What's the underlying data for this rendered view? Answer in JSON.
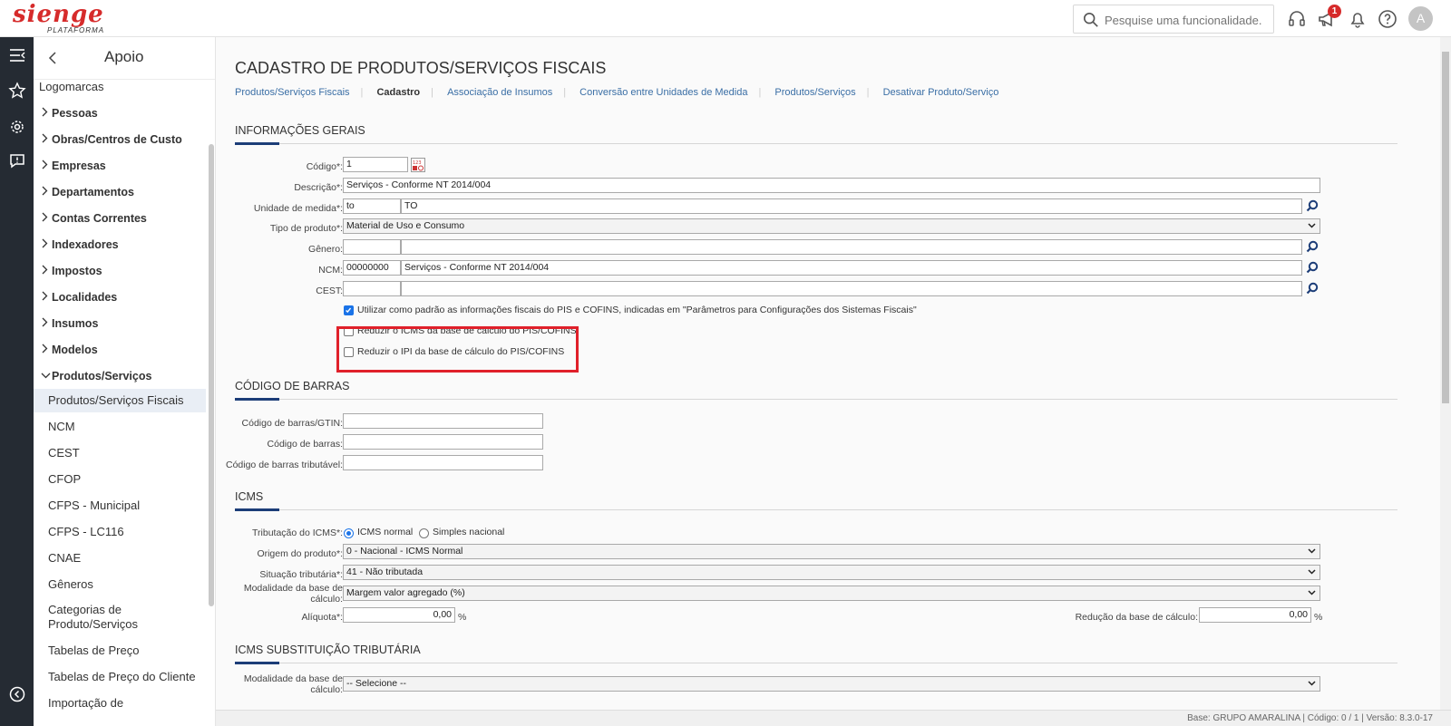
{
  "logo": {
    "brand": "sienge",
    "sub": "PLATAFORMA"
  },
  "search": {
    "placeholder": "Pesquise uma funcionalidade."
  },
  "notifications": {
    "count": "1"
  },
  "user": {
    "initial": "A"
  },
  "sidebar": {
    "title": "Apoio",
    "items": [
      {
        "label": "Logomarcas",
        "kind": "leaf"
      },
      {
        "label": "Pessoas",
        "kind": "group",
        "open": false
      },
      {
        "label": "Obras/Centros de Custo",
        "kind": "group",
        "open": false
      },
      {
        "label": "Empresas",
        "kind": "group",
        "open": false
      },
      {
        "label": "Departamentos",
        "kind": "group",
        "open": false
      },
      {
        "label": "Contas Correntes",
        "kind": "group",
        "open": false
      },
      {
        "label": "Indexadores",
        "kind": "group",
        "open": false
      },
      {
        "label": "Impostos",
        "kind": "group",
        "open": false
      },
      {
        "label": "Localidades",
        "kind": "group",
        "open": false
      },
      {
        "label": "Insumos",
        "kind": "group",
        "open": false
      },
      {
        "label": "Modelos",
        "kind": "group",
        "open": false
      },
      {
        "label": "Produtos/Serviços",
        "kind": "group",
        "open": true
      },
      {
        "label": "Produtos/Serviços Fiscais",
        "kind": "sub",
        "active": true
      },
      {
        "label": "NCM",
        "kind": "sub"
      },
      {
        "label": "CEST",
        "kind": "sub"
      },
      {
        "label": "CFOP",
        "kind": "sub"
      },
      {
        "label": "CFPS - Municipal",
        "kind": "sub"
      },
      {
        "label": "CFPS - LC116",
        "kind": "sub"
      },
      {
        "label": "CNAE",
        "kind": "sub"
      },
      {
        "label": "Gêneros",
        "kind": "sub"
      },
      {
        "label": "Categorias de Produto/Serviços",
        "kind": "sub"
      },
      {
        "label": "Tabelas de Preço",
        "kind": "sub"
      },
      {
        "label": "Tabelas de Preço do Cliente",
        "kind": "sub"
      },
      {
        "label": "Importação de",
        "kind": "sub"
      }
    ]
  },
  "page": {
    "title": "CADASTRO DE PRODUTOS/SERVIÇOS FISCAIS"
  },
  "tabs": [
    "Produtos/Serviços Fiscais",
    "Cadastro",
    "Associação de Insumos",
    "Conversão entre Unidades de Medida",
    "Produtos/Serviços",
    "Desativar Produto/Serviço"
  ],
  "general": {
    "section": "INFORMAÇÕES GERAIS",
    "codigo_label": "Código*:",
    "codigo": "1",
    "descricao_label": "Descrição*:",
    "descricao": "Serviços - Conforme NT 2014/004",
    "unidade_label": "Unidade de medida*:",
    "unidade_code": "to",
    "unidade_name": "TO",
    "tipo_label": "Tipo de produto*:",
    "tipo": "Material de Uso e Consumo",
    "genero_label": "Gênero:",
    "genero_code": "",
    "genero_name": "",
    "ncm_label": "NCM:",
    "ncm_code": "00000000",
    "ncm_name": "Serviços - Conforme NT 2014/004",
    "cest_label": "CEST:",
    "cest_code": "",
    "cest_name": "",
    "cb1": "Utilizar como padrão as informações fiscais do PIS e COFINS, indicadas em \"Parâmetros para Configurações dos Sistemas Fiscais\"",
    "cb2": "Reduzir o ICMS da base de cálculo do PIS/COFINS",
    "cb3": "Reduzir o IPI da base de cálculo do PIS/COFINS"
  },
  "barcode": {
    "section": "CÓDIGO DE BARRAS",
    "gtin_label": "Código de barras/GTIN:",
    "gtin": "",
    "code_label": "Código de barras:",
    "code": "",
    "trib_label": "Código de barras tributável:",
    "trib": ""
  },
  "icms": {
    "section": "ICMS",
    "trib_label": "Tributação do ICMS*:",
    "opt1": "ICMS normal",
    "opt2": "Simples nacional",
    "origem_label": "Origem do produto*:",
    "origem": "0 - Nacional - ICMS Normal",
    "situacao_label": "Situação tributária*:",
    "situacao": "41 - Não tributada",
    "modal_label1": "Modalidade da base de",
    "modal_label2": "cálculo:",
    "modal": "Margem valor agregado (%)",
    "aliquota_label": "Alíquota*:",
    "aliquota": "0,00",
    "pct": "%",
    "reducao_label": "Redução da base de cálculo:",
    "reducao": "0,00"
  },
  "icms_st": {
    "section": "ICMS SUBSTITUIÇÃO TRIBUTÁRIA",
    "modal_label1": "Modalidade da base de",
    "modal_label2": "cálculo:",
    "modal": "-- Selecione --"
  },
  "footer": {
    "text": "Base: GRUPO AMARALINA | Código: 0 / 1 | Versão: 8.3.0-17"
  }
}
